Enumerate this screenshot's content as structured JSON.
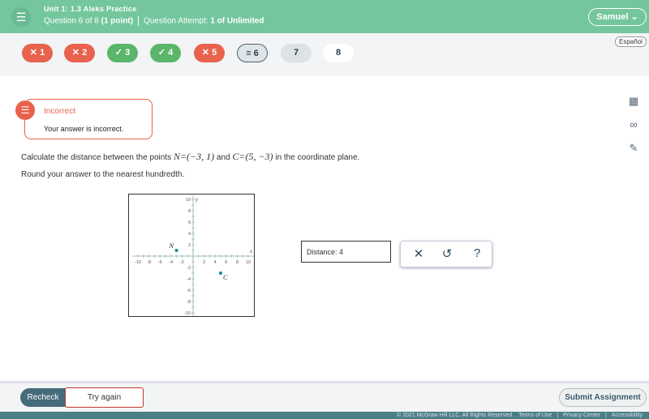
{
  "header": {
    "unit": "Unit 1: 1.3 Aleks Practice",
    "question": "Question 6 of 8",
    "points": "(1 point)",
    "attempt_label": "Question Attempt:",
    "attempt_value": "1 of Unlimited",
    "user": "Samuel"
  },
  "questions": [
    {
      "label": "✕ 1",
      "status": "incorrect"
    },
    {
      "label": "✕ 2",
      "status": "incorrect"
    },
    {
      "label": "✓ 3",
      "status": "correct"
    },
    {
      "label": "✓ 4",
      "status": "correct"
    },
    {
      "label": "✕ 5",
      "status": "incorrect"
    },
    {
      "label": "≡ 6",
      "status": "current"
    },
    {
      "label": "7",
      "status": "unanswered"
    },
    {
      "label": "8",
      "status": "unanswered"
    }
  ],
  "language": "Español",
  "feedback": {
    "title": "Incorrect",
    "message": "Your answer is incorrect."
  },
  "problem": {
    "text1": "Calculate the distance between the points ",
    "p1": "N=(−3, 1)",
    "and": " and ",
    "p2": "C=(5, −3)",
    "text2": " in the coordinate plane.",
    "round": "Round your answer to the nearest hundredth."
  },
  "graph": {
    "xrange": [
      -10,
      10
    ],
    "yrange": [
      -10,
      10
    ],
    "xticks": [
      "-10",
      "-8",
      "-6",
      "-4",
      "-2",
      "2",
      "4",
      "6",
      "8",
      "10"
    ],
    "yticks": [
      "10",
      "8",
      "6",
      "4",
      "2",
      "-2",
      "-4",
      "-6",
      "-8",
      "-10"
    ],
    "xlabel": "x",
    "ylabel": "y",
    "points": [
      {
        "label": "N",
        "x": -3,
        "y": 1
      },
      {
        "label": "C",
        "x": 5,
        "y": -3
      }
    ],
    "point_color": "#1a8a8a"
  },
  "answer": {
    "label": "Distance:",
    "value": "4"
  },
  "tools": {
    "clear": "✕",
    "undo": "↺",
    "help": "?"
  },
  "footer": {
    "recheck": "Recheck",
    "try_again": "Try again",
    "submit": "Submit Assignment",
    "copyright": "© 2021 McGraw Hill LLC. All Rights Reserved.",
    "terms": "Terms of Use",
    "privacy": "Privacy Center",
    "accessibility": "Accessibility"
  },
  "colors": {
    "header": "#74c69d",
    "incorrect": "#e8624d",
    "correct": "#5bb66b"
  }
}
